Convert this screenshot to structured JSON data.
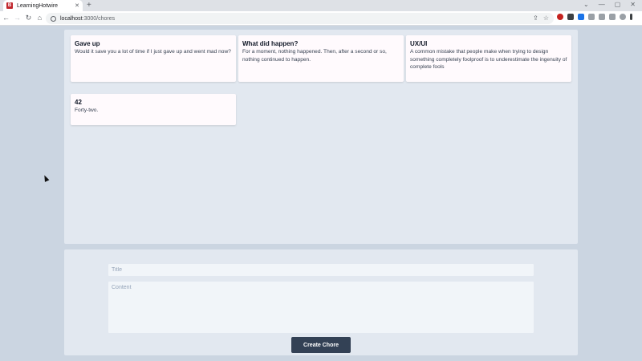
{
  "browser": {
    "tab": {
      "title": "LearningHotwire",
      "favicon_letter": "B",
      "close_glyph": "✕"
    },
    "new_tab_glyph": "+",
    "window_controls": {
      "minimize": "⌄",
      "chevron": "—",
      "maximize": "▢",
      "close": "✕"
    },
    "url": {
      "host": "localhost",
      "path": ":3000/chores"
    },
    "icons": [
      "back-icon",
      "forward-icon",
      "reload-icon",
      "home-icon",
      "share-icon",
      "star-icon",
      "menu-icon"
    ]
  },
  "chores": [
    {
      "title": "Gave up",
      "content": "Would it save you a lot of time if I just gave up and went mad now?"
    },
    {
      "title": "What did happen?",
      "content": "For a moment, nothing happened. Then, after a second or so, nothing continued to happen."
    },
    {
      "title": "UX/UI",
      "content": "A common mistake that people make when trying to design something completely foolproof is to underestimate the ingenuity of complete fools"
    },
    {
      "title": "42",
      "content": "Forty-two."
    }
  ],
  "form": {
    "title_placeholder": "Title",
    "content_placeholder": "Content",
    "submit_label": "Create Chore"
  },
  "colors": {
    "page_bg": "#cbd5e1",
    "panel_bg": "#e2e8f0",
    "card_bg": "#fffafd",
    "button_bg": "#334155"
  }
}
